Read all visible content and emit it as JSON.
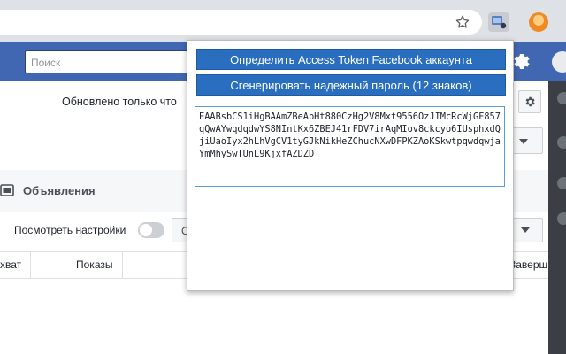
{
  "browser": {
    "icons": [
      "star-icon",
      "extension-icon",
      "profile-avatar"
    ]
  },
  "fb": {
    "search_placeholder": "Поиск"
  },
  "page": {
    "updated_text": "Обновлено только что",
    "section_title": "Объявления",
    "view_settings_label": "Посмотреть настройки",
    "filter_partial": "С",
    "columns": [
      "хват",
      "Показы",
      "Заверш"
    ]
  },
  "popup": {
    "btn_token": "Определить Access Token Facebook аккаунта",
    "btn_password": "Сгенерировать надежный пароль (12 знаков)",
    "token_value": "EAABsbCS1iHgBAAmZBeAbHt880CzHg2V8Mxt9556OzJIMcRcWjGF857qQwAYwqdqdwYS8NIntKx6ZBEJ41rFDV7irAqMIov8ckcyo6IUsphxdQjiUaoIyx2hLhVgCV1tyGJkNikHeZChucNXwDFPKZAoKSkwtpqwdqwjaYmMhySwTUnL9KjxfAZDZD"
  },
  "colors": {
    "fb_blue": "#4267b2",
    "popup_button": "#2a6fbf"
  }
}
